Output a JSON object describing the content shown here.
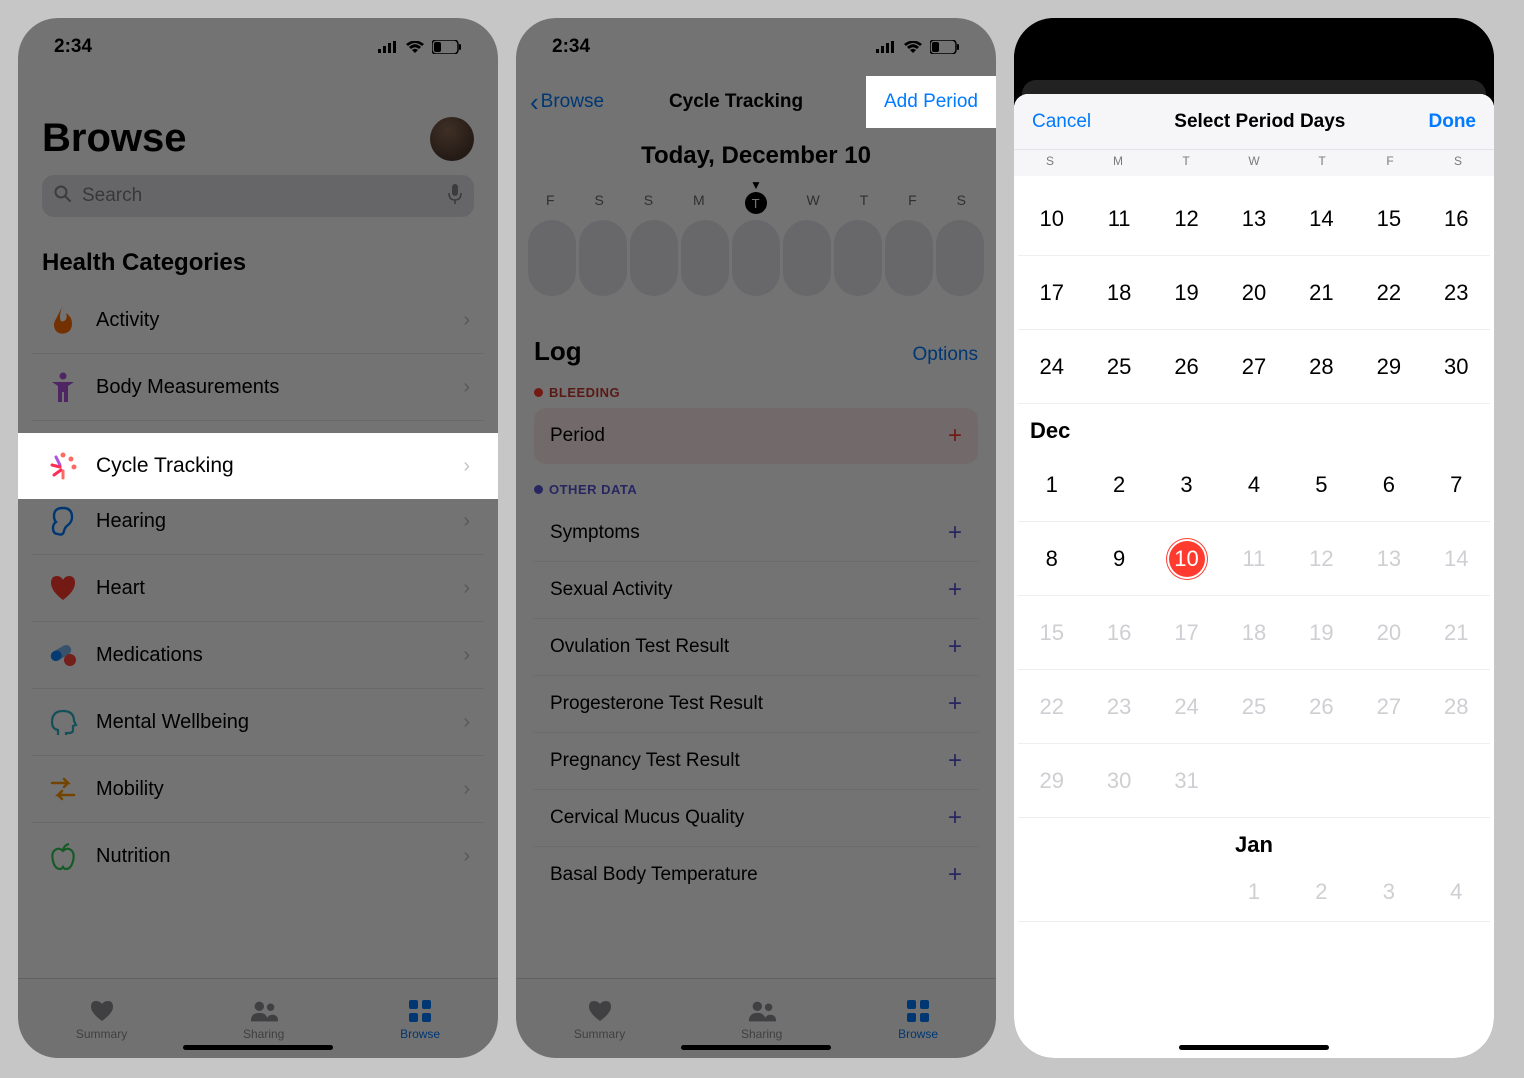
{
  "status": {
    "time": "2:34",
    "battery": "29"
  },
  "colors": {
    "accent": "#007aff",
    "red": "#ff3b30",
    "purple": "#5856d6"
  },
  "phone1": {
    "title": "Browse",
    "search_placeholder": "Search",
    "section": "Health Categories",
    "categories": [
      {
        "label": "Activity",
        "icon": "flame-icon"
      },
      {
        "label": "Body Measurements",
        "icon": "body-icon"
      },
      {
        "label": "Cycle Tracking",
        "icon": "cycle-icon"
      },
      {
        "label": "Hearing",
        "icon": "ear-icon"
      },
      {
        "label": "Heart",
        "icon": "heart-icon"
      },
      {
        "label": "Medications",
        "icon": "pill-icon"
      },
      {
        "label": "Mental Wellbeing",
        "icon": "mind-icon"
      },
      {
        "label": "Mobility",
        "icon": "mobility-icon"
      },
      {
        "label": "Nutrition",
        "icon": "nutrition-icon"
      }
    ],
    "tabs": {
      "summary": "Summary",
      "sharing": "Sharing",
      "browse": "Browse"
    }
  },
  "phone2": {
    "back": "Browse",
    "title": "Cycle Tracking",
    "action": "Add Period",
    "date_title": "Today, December 10",
    "week_letters": [
      "F",
      "S",
      "S",
      "M",
      "T",
      "W",
      "T",
      "F",
      "S"
    ],
    "log_title": "Log",
    "log_options": "Options",
    "bleeding_label": "BLEEDING",
    "period_label": "Period",
    "other_label": "OTHER DATA",
    "other_rows": [
      "Symptoms",
      "Sexual Activity",
      "Ovulation Test Result",
      "Progesterone Test Result",
      "Pregnancy Test Result",
      "Cervical Mucus Quality",
      "Basal Body Temperature"
    ],
    "tabs": {
      "summary": "Summary",
      "sharing": "Sharing",
      "browse": "Browse"
    }
  },
  "phone3": {
    "cancel": "Cancel",
    "title": "Select Period Days",
    "done": "Done",
    "dow": [
      "S",
      "M",
      "T",
      "W",
      "T",
      "F",
      "S"
    ],
    "nov_weeks": [
      [
        "10",
        "11",
        "12",
        "13",
        "14",
        "15",
        "16"
      ],
      [
        "17",
        "18",
        "19",
        "20",
        "21",
        "22",
        "23"
      ],
      [
        "24",
        "25",
        "26",
        "27",
        "28",
        "29",
        "30"
      ]
    ],
    "dec_label": "Dec",
    "dec_weeks": [
      {
        "cells": [
          "1",
          "2",
          "3",
          "4",
          "5",
          "6",
          "7"
        ],
        "dim_from": 99
      },
      {
        "cells": [
          "8",
          "9",
          "10",
          "11",
          "12",
          "13",
          "14"
        ],
        "dim_from": 3,
        "selected": 2
      },
      {
        "cells": [
          "15",
          "16",
          "17",
          "18",
          "19",
          "20",
          "21"
        ],
        "dim_from": 0
      },
      {
        "cells": [
          "22",
          "23",
          "24",
          "25",
          "26",
          "27",
          "28"
        ],
        "dim_from": 0
      },
      {
        "cells": [
          "29",
          "30",
          "31",
          "",
          "",
          "",
          ""
        ],
        "dim_from": 0
      }
    ],
    "jan_label": "Jan",
    "jan_week": [
      "",
      "",
      "",
      "1",
      "2",
      "3",
      "4"
    ]
  }
}
